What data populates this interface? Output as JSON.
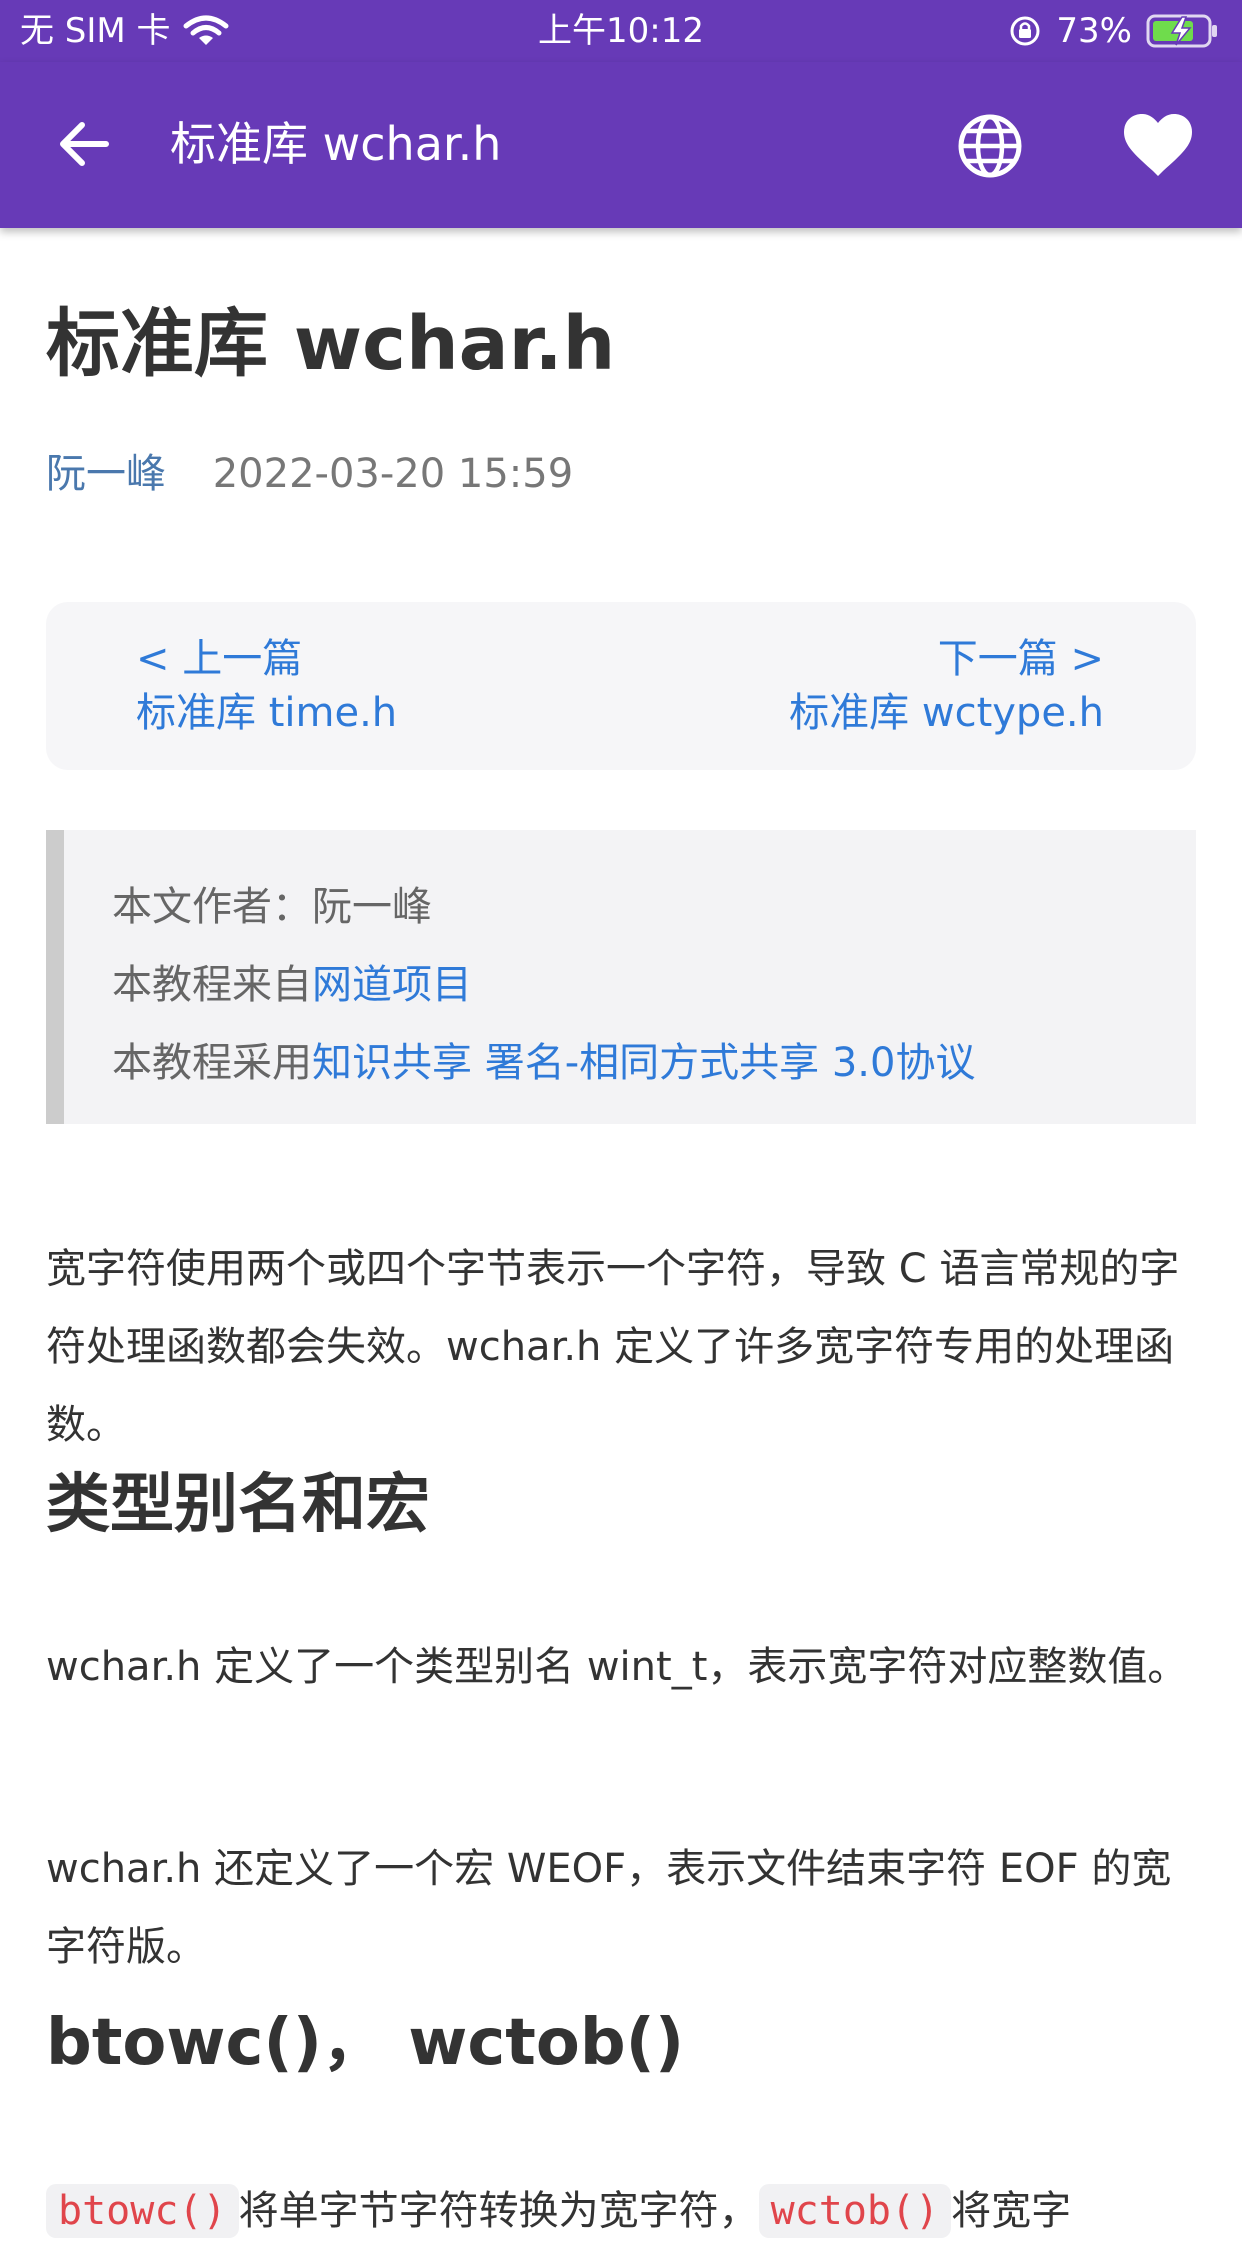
{
  "status_bar": {
    "carrier": "无 SIM 卡",
    "time": "上午10:12",
    "battery": "73%"
  },
  "app_bar": {
    "title": "标准库 wchar.h"
  },
  "article": {
    "title": "标准库 wchar.h",
    "author": "阮一峰",
    "date": "2022-03-20 15:59",
    "nav": {
      "prev_label": "<  上一篇",
      "prev_title": "标准库 time.h",
      "next_label": "下一篇  >",
      "next_title": "标准库 wctype.h"
    },
    "quote": {
      "line1": "本文作者：阮一峰",
      "line2_prefix": "本教程来自",
      "line2_link": "网道项目",
      "line3_prefix": "本教程采用",
      "line3_link": "知识共享 署名-相同方式共享 3.0协议"
    },
    "intro": "宽字符使用两个或四个字节表示一个字符，导致 C 语言常规的字符处理函数都会失效。wchar.h 定义了许多宽字符专用的处理函数。",
    "section1_heading": "类型别名和宏",
    "section1_para1": "wchar.h 定义了一个类型别名 wint_t，表示宽字符对应整数值。",
    "section1_para2": "wchar.h 还定义了一个宏 WEOF，表示文件结束字符 EOF 的宽字符版。",
    "section2_heading": "btowc()， wctob()",
    "section2_code1": "btowc()",
    "section2_text1": "将单字节字符转换为宽字符，",
    "section2_code2": "wctob()",
    "section2_text2": "将宽字"
  },
  "colors": {
    "primary": "#673ab7",
    "link": "#2f7ad8",
    "code": "#e0454b"
  },
  "icons": [
    "back-arrow-icon",
    "globe-icon",
    "heart-icon",
    "wifi-icon",
    "orientation-lock-icon",
    "battery-charging-icon"
  ]
}
